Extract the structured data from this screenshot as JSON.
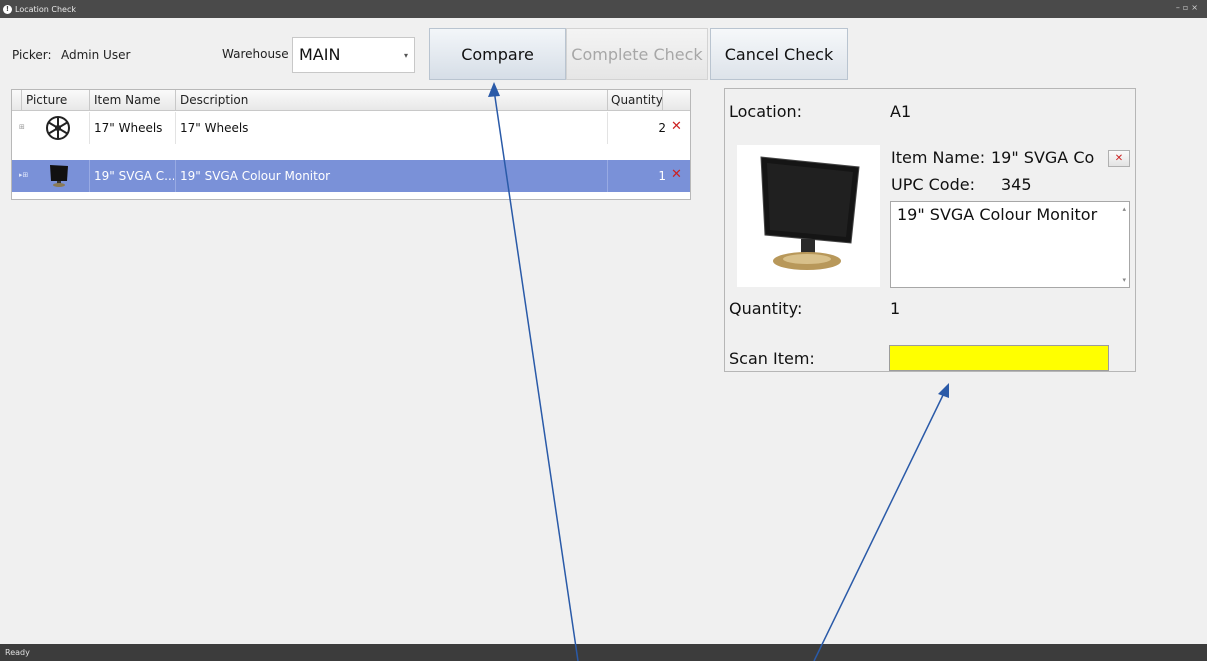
{
  "window": {
    "title": "Location Check",
    "status": "Ready"
  },
  "toolbar": {
    "picker_label": "Picker:",
    "picker_value": "Admin User",
    "warehouse_label": "Warehouse",
    "warehouse_value": "MAIN",
    "compare_label": "Compare",
    "complete_label": "Complete Check",
    "cancel_label": "Cancel Check"
  },
  "grid": {
    "columns": [
      "Picture",
      "Item Name",
      "Description",
      "Quantity"
    ],
    "rows": [
      {
        "icon": "wheel-icon",
        "item_name": "17\" Wheels",
        "description": "17\" Wheels",
        "quantity": "2",
        "selected": false
      },
      {
        "icon": "monitor-icon",
        "item_name": "19\" SVGA C...",
        "description": "19\" SVGA Colour Monitor",
        "quantity": "1",
        "selected": true
      }
    ]
  },
  "detail": {
    "location_label": "Location:",
    "location_value": "A1",
    "item_name_label": "Item Name:",
    "item_name_value": "19\" SVGA Co",
    "upc_label": "UPC Code:",
    "upc_value": "345",
    "description": "19\" SVGA Colour Monitor",
    "quantity_label": "Quantity:",
    "quantity_value": "1",
    "scan_label": "Scan Item:",
    "scan_value": ""
  },
  "colors": {
    "selection": "#7a91d8",
    "scan_field": "#ffff00",
    "delete_icon": "#cc2222",
    "arrow": "#2a5aa8",
    "title_bar": "#4a4a4a",
    "status_bar": "#3c3c3c"
  }
}
